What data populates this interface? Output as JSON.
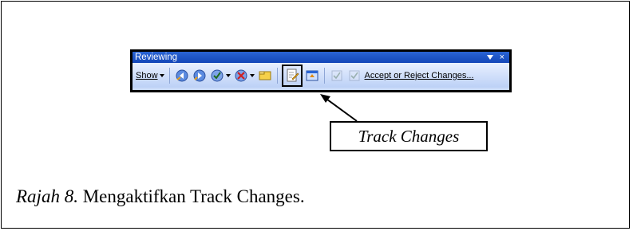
{
  "toolbar": {
    "title": "Reviewing",
    "show_label": "Show",
    "accept_reject_label": "Accept or Reject Changes..."
  },
  "icons": {
    "previous": "previous-change-icon",
    "next": "next-change-icon",
    "accept": "accept-change-icon",
    "reject": "reject-change-icon",
    "comment": "insert-comment-icon",
    "track_changes": "track-changes-icon",
    "reviewing_pane": "reviewing-pane-icon",
    "accept_all": "accept-all-icon",
    "reject_all": "reject-all-icon"
  },
  "callout": {
    "label": "Track Changes"
  },
  "caption": {
    "figure_number": "Rajah 8.",
    "text": " Mengaktifkan Track Changes."
  }
}
